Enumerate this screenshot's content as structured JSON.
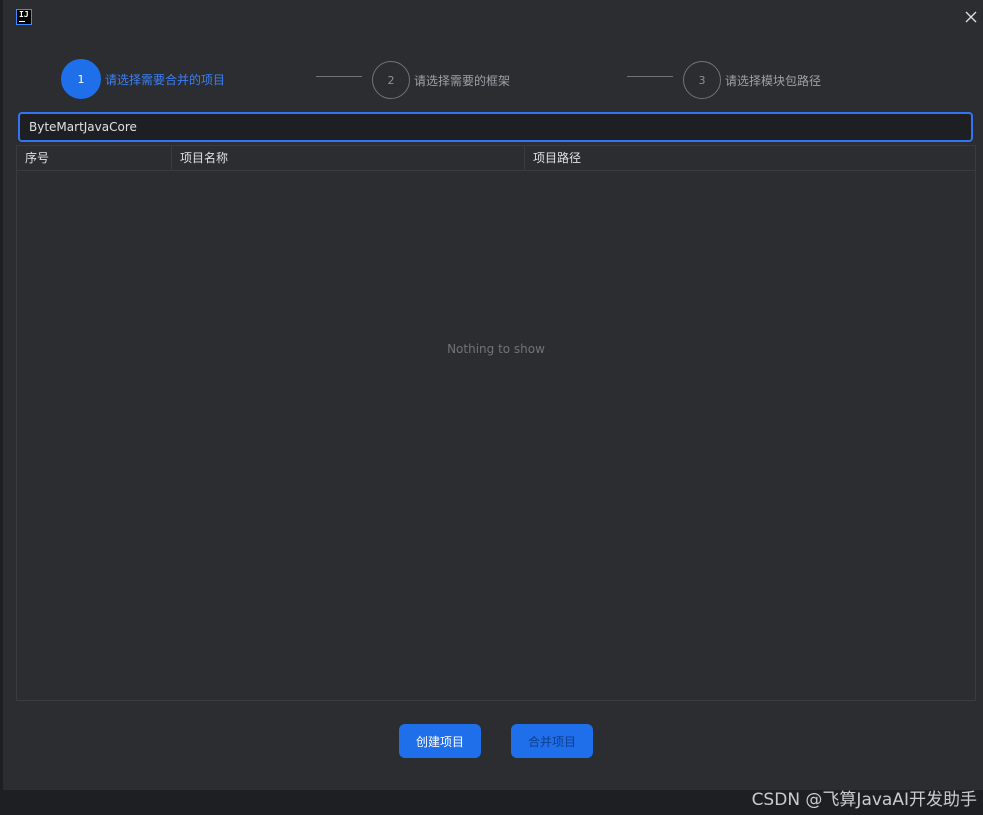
{
  "window": {
    "logo_text": "IJ"
  },
  "steps": [
    {
      "number": "1",
      "label": "请选择需要合并的项目",
      "active": true
    },
    {
      "number": "2",
      "label": "请选择需要的框架",
      "active": false
    },
    {
      "number": "3",
      "label": "请选择模块包路径",
      "active": false
    }
  ],
  "search": {
    "value": "ByteMartJavaCore"
  },
  "table": {
    "columns": [
      "序号",
      "项目名称",
      "项目路径"
    ],
    "rows": [],
    "empty_text": "Nothing to show"
  },
  "buttons": {
    "create": "创建项目",
    "merge": "合并项目"
  },
  "watermark": "CSDN @飞算JavaAI开发助手",
  "colors": {
    "accent": "#1f6feb",
    "background": "#2b2d30",
    "border": "#393b40"
  }
}
